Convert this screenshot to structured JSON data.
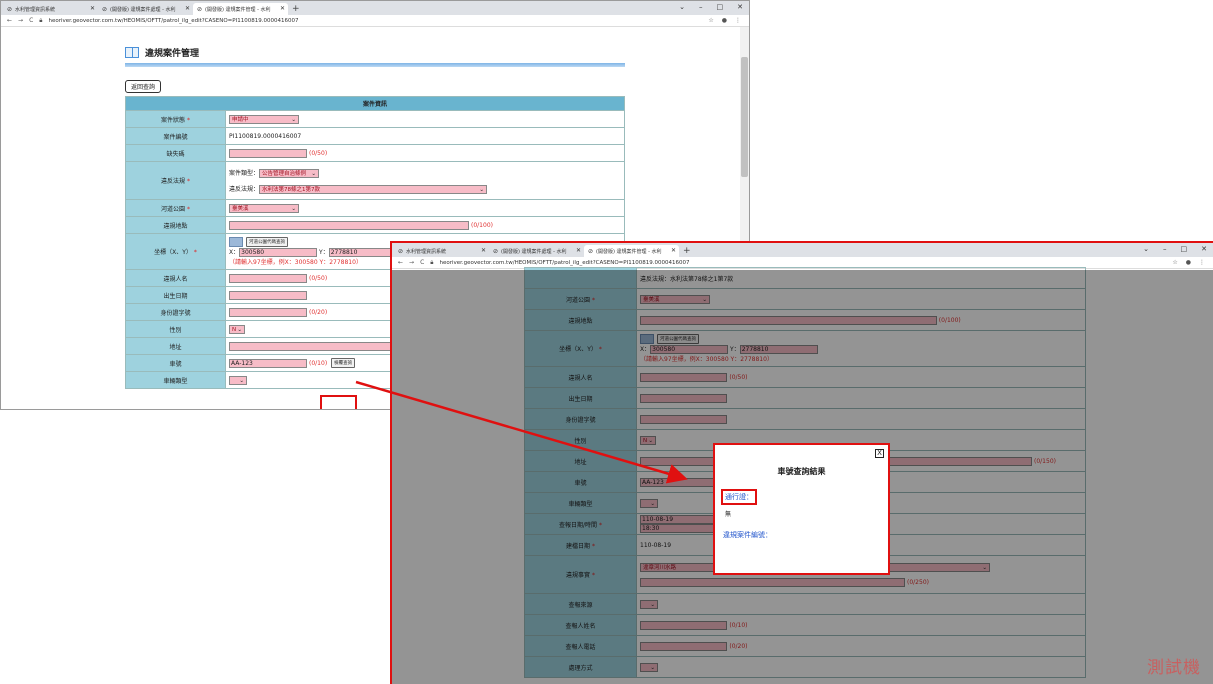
{
  "w1": {
    "tabs": [
      {
        "label": "水利管理資訊系統"
      },
      {
        "label": "(開發版) 違規案件處理 - 水利"
      },
      {
        "label": "(開發版) 違規案件管理 - 水利"
      }
    ],
    "url": "heoriver.geovector.com.tw/HEOMIS/OFTT/patrol_ilg_edit?CASENO=PI1100819.0000416007",
    "page_title": "違規案件管理",
    "back_label": "返回查詢",
    "form_header": "案件資訊",
    "rows": [
      {
        "label": "案件狀態",
        "req": true,
        "kind": "select",
        "value": "申請中"
      },
      {
        "label": "案件編號",
        "req": false,
        "kind": "text",
        "value": "PI1100819.0000416007"
      },
      {
        "label": "缺失碼",
        "req": false,
        "kind": "input",
        "value": "",
        "count": "(0/50)"
      },
      {
        "label": "違反法規",
        "req": true,
        "kind": "law",
        "l1": "案件類型：",
        "v1": "公告管理自治條例",
        "l2": "違反法規：",
        "v2": "水利法第78條之1第7款"
      },
      {
        "label": "河道公園",
        "req": true,
        "kind": "select",
        "value": "臺美溪"
      },
      {
        "label": "違規地點",
        "req": false,
        "kind": "input",
        "value": "",
        "count": "(0/100)"
      },
      {
        "label": "坐標（X、Y）",
        "req": true,
        "kind": "coord",
        "btn": "河道公園代碼查詢",
        "x": "300580",
        "y": "2778810",
        "hint": "（請輸入97坐標，例X：300580 Y：2778810）"
      },
      {
        "label": "違規人名",
        "req": false,
        "kind": "input",
        "value": "",
        "count": "(0/50)"
      },
      {
        "label": "出生日期",
        "req": false,
        "kind": "input",
        "value": ""
      },
      {
        "label": "身份證字號",
        "req": false,
        "kind": "input",
        "value": "",
        "count": "(0/20)"
      },
      {
        "label": "性別",
        "req": false,
        "kind": "select",
        "value": "N"
      },
      {
        "label": "地址",
        "req": false,
        "kind": "input",
        "value": ""
      },
      {
        "label": "車號",
        "req": false,
        "kind": "plate",
        "value": "AA-123",
        "count": "(0/10)",
        "btn": "檢覆查詢"
      },
      {
        "label": "車輛類型",
        "req": false,
        "kind": "select",
        "value": ""
      }
    ]
  },
  "w2": {
    "tabs": [
      {
        "label": "水利管理資訊系統"
      },
      {
        "label": "(開發版) 違規案件處理 - 水利"
      },
      {
        "label": "(開發版) 違規案件管理 - 水利"
      }
    ],
    "url": "heoriver.geovector.com.tw/HEOMIS/OFTT/patrol_ilg_edit?CASENO=PI1100819.0000416007",
    "top_law": "違反法規：水利法第78條之1第7款",
    "rows": [
      {
        "label": "河道公園",
        "req": true,
        "kind": "select",
        "value": "臺美溪"
      },
      {
        "label": "違規地點",
        "req": false,
        "kind": "input",
        "value": "",
        "count": "(0/100)"
      },
      {
        "label": "坐標（X、Y）",
        "req": true,
        "kind": "coord",
        "btn": "河道公園代碼查詢",
        "x": "300580",
        "y": "2778810",
        "hint": "（請輸入97坐標，例X：300580 Y：2778810）"
      },
      {
        "label": "違規人名",
        "req": false,
        "kind": "input",
        "value": "",
        "count": "(0/50)"
      },
      {
        "label": "出生日期",
        "req": false,
        "kind": "input",
        "value": ""
      },
      {
        "label": "身份證字號",
        "req": false,
        "kind": "input",
        "value": ""
      },
      {
        "label": "性別",
        "req": false,
        "kind": "select",
        "value": "N"
      },
      {
        "label": "地址",
        "req": false,
        "kind": "input",
        "value": "",
        "count": "(0/150)"
      },
      {
        "label": "車號",
        "req": false,
        "kind": "input",
        "value": "AA-123"
      },
      {
        "label": "車輛類型",
        "req": false,
        "kind": "select",
        "value": ""
      },
      {
        "label": "查報日期/時間",
        "req": true,
        "kind": "datetime",
        "d": "110-08-19",
        "t": "18:30"
      },
      {
        "label": "建檔日期",
        "req": true,
        "kind": "text",
        "value": "110-08-19"
      },
      {
        "label": "違規事實",
        "req": true,
        "kind": "fact",
        "value": "違章河川水路",
        "count": "(0/250)"
      },
      {
        "label": "查報來源",
        "req": false,
        "kind": "select",
        "value": ""
      },
      {
        "label": "查報人姓名",
        "req": false,
        "kind": "input",
        "value": "",
        "count": "(0/10)"
      },
      {
        "label": "查報人電話",
        "req": false,
        "kind": "input",
        "value": "",
        "count": "(0/20)"
      },
      {
        "label": "處理方式",
        "req": false,
        "kind": "select",
        "value": ""
      }
    ]
  },
  "modal": {
    "close": "X",
    "title": "車號查詢結果",
    "label1": "通行證：",
    "value1": "無",
    "label2": "違規案件編號："
  },
  "watermark": "測試機",
  "colors": {
    "highlight": "#e01010",
    "label_bg": "#9ed2de",
    "input_bg": "#f7bcc7",
    "header_bg": "#69b4cf"
  }
}
